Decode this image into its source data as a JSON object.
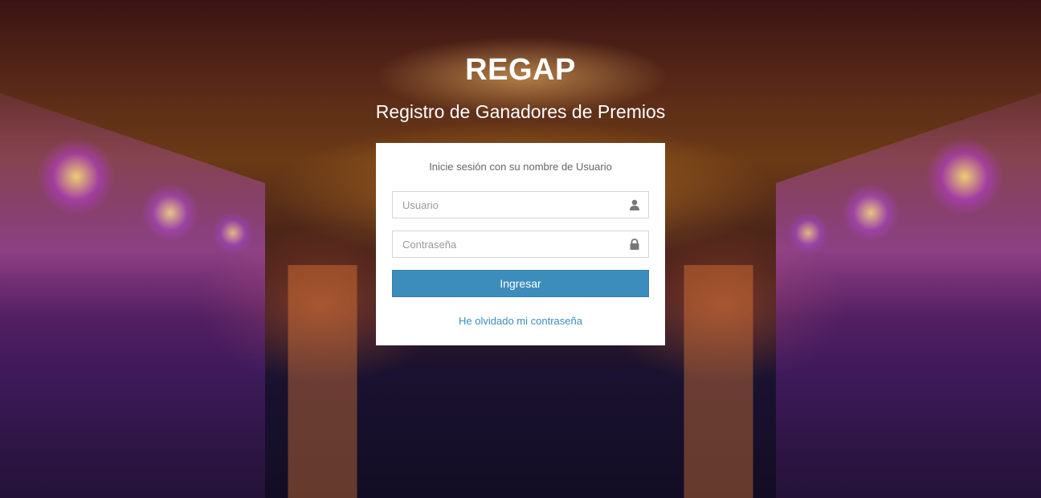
{
  "header": {
    "title": "REGAP",
    "subtitle": "Registro de Ganadores de Premios"
  },
  "login": {
    "message": "Inicie sesión con su nombre de Usuario",
    "username": {
      "placeholder": "Usuario",
      "value": "",
      "icon": "user-icon"
    },
    "password": {
      "placeholder": "Contraseña",
      "value": "",
      "icon": "lock-icon"
    },
    "submit_label": "Ingresar",
    "forgot_label": "He olvidado mi contraseña"
  },
  "colors": {
    "primary": "#3c8dbc",
    "box_background": "#ffffff",
    "title_text": "#ffffff"
  }
}
